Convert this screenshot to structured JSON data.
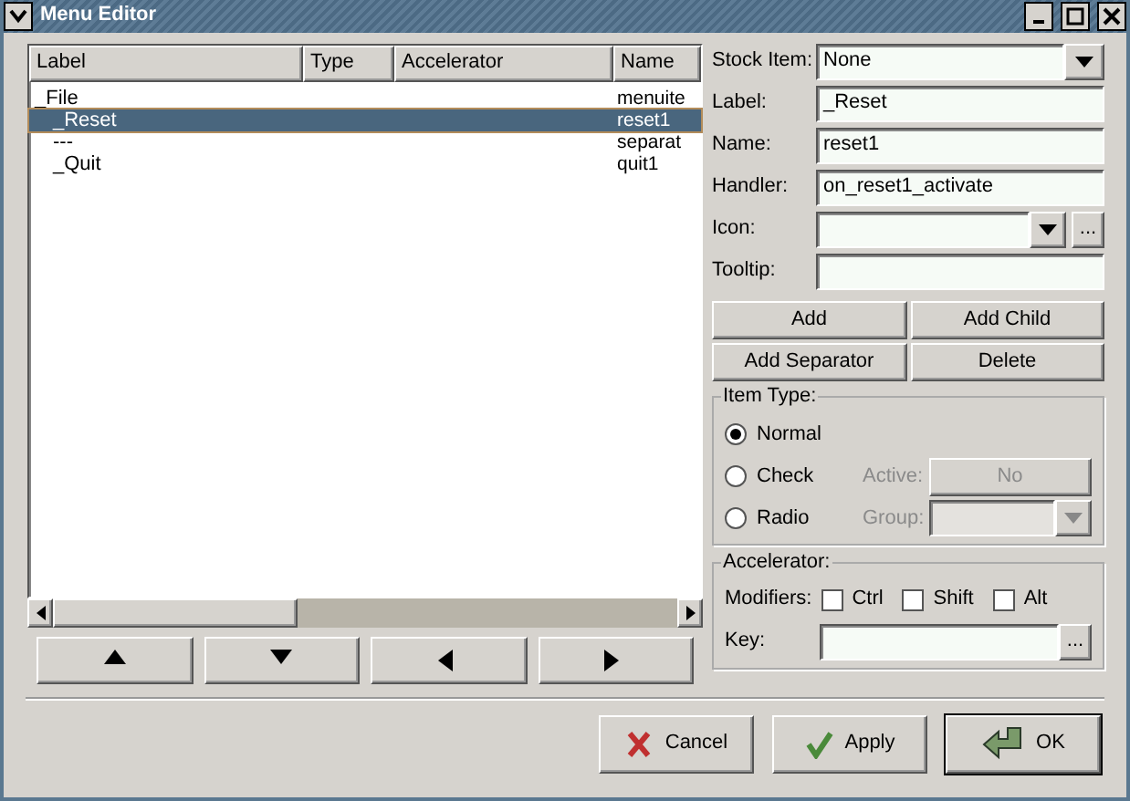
{
  "window": {
    "title": "Menu Editor"
  },
  "tree": {
    "columns": [
      "Label",
      "Type",
      "Accelerator",
      "Name"
    ],
    "rows": [
      {
        "label": "_File",
        "type": "",
        "accelerator": "",
        "name": "menuite",
        "selected": false,
        "children": [
          {
            "label": "_Reset",
            "name": "reset1",
            "selected": true
          },
          {
            "label": "---",
            "name": "separat",
            "selected": false
          },
          {
            "label": "_Quit",
            "name": "quit1",
            "selected": false
          }
        ]
      }
    ]
  },
  "move_buttons": [
    {
      "kind": "up"
    },
    {
      "kind": "down"
    },
    {
      "kind": "left"
    },
    {
      "kind": "right"
    }
  ],
  "properties": {
    "stock_item": {
      "label": "Stock Item:",
      "value": "None"
    },
    "fields": [
      {
        "label": "Label:",
        "value": "_Reset"
      },
      {
        "label": "Name:",
        "value": "reset1"
      },
      {
        "label": "Handler:",
        "value": "on_reset1_activate"
      }
    ],
    "icon": {
      "label": "Icon:",
      "browse": "..."
    },
    "tooltip": {
      "label": "Tooltip:"
    }
  },
  "actions": [
    {
      "label": "Add"
    },
    {
      "label": "Add Child"
    },
    {
      "label": "Add Separator"
    },
    {
      "label": "Delete"
    }
  ],
  "item_type": {
    "title": "Item Type:",
    "options": [
      {
        "label": "Normal",
        "selected": true
      },
      {
        "label": "Check",
        "selected": false
      },
      {
        "label": "Radio",
        "selected": false
      }
    ],
    "active": {
      "label": "Active:",
      "value": "No",
      "disabled": true
    },
    "group": {
      "label": "Group:",
      "disabled": true
    }
  },
  "accelerator": {
    "title": "Accelerator:",
    "modifiers_label": "Modifiers:",
    "modifiers": [
      {
        "label": "Ctrl",
        "checked": false
      },
      {
        "label": "Shift",
        "checked": false
      },
      {
        "label": "Alt",
        "checked": false
      }
    ],
    "key_label": "Key:",
    "key_browse": "..."
  },
  "dialog_buttons": [
    {
      "kind": "cancel",
      "label": "Cancel",
      "default": false
    },
    {
      "kind": "apply",
      "label": "Apply",
      "default": false
    },
    {
      "kind": "ok",
      "label": "OK",
      "default": true
    }
  ]
}
